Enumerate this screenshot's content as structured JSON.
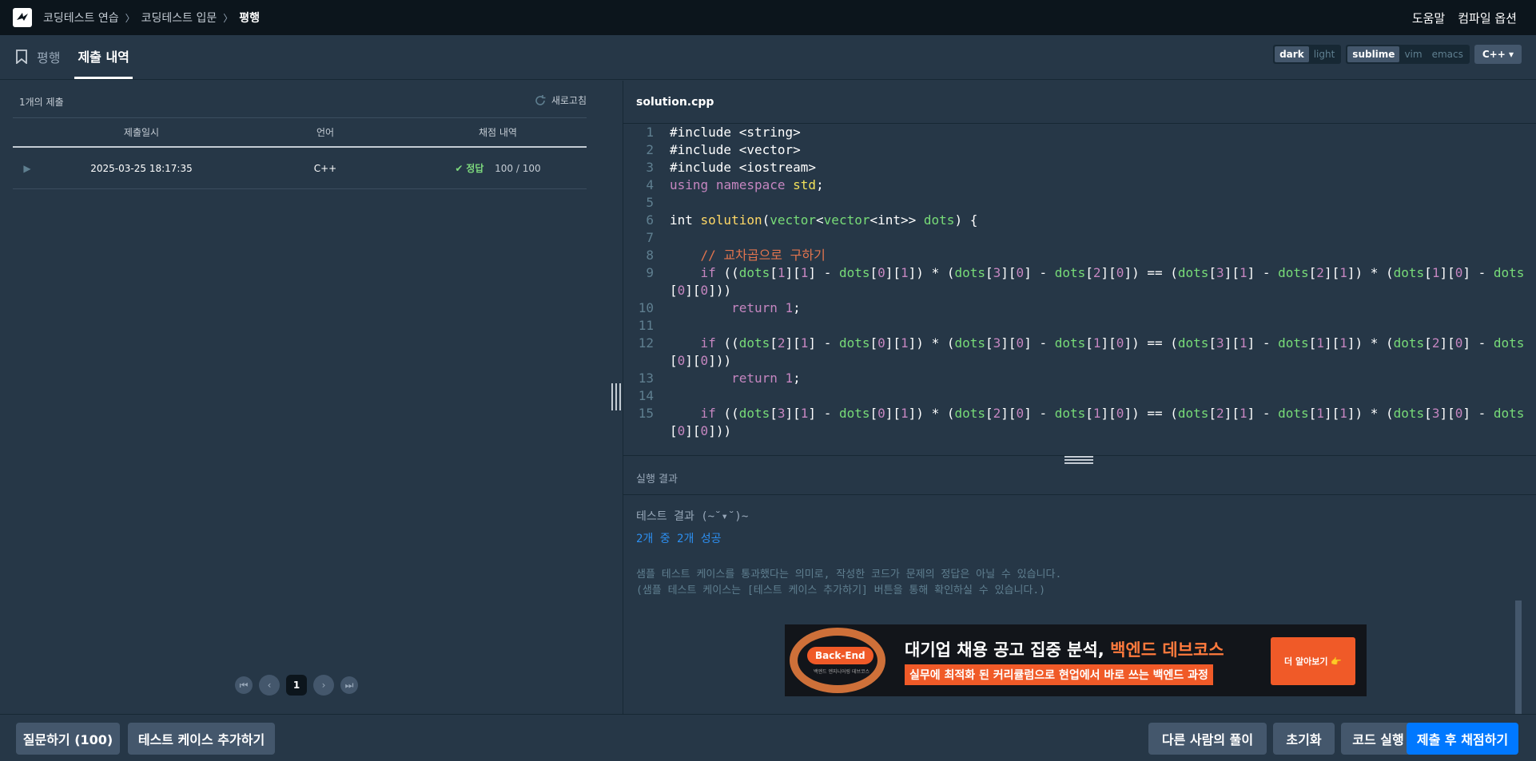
{
  "topbar": {
    "breadcrumb": [
      "코딩테스트 연습",
      "코딩테스트 입문",
      "평행"
    ],
    "help": "도움말",
    "compile_options": "컴파일 옵션"
  },
  "tabs": {
    "problem": "평행",
    "submissions": "제출 내역"
  },
  "editor_options": {
    "theme": [
      "dark",
      "light"
    ],
    "keymap": [
      "sublime",
      "vim",
      "emacs"
    ],
    "language": "C++"
  },
  "submissions": {
    "count_label": "1개의 제출",
    "refresh_label": "새로고침",
    "columns": [
      "제출일시",
      "언어",
      "채점 내역"
    ],
    "rows": [
      {
        "date": "2025-03-25 18:17:35",
        "lang": "C++",
        "status": "정답",
        "score": "100 / 100"
      }
    ],
    "pagination": {
      "current": "1"
    }
  },
  "editor": {
    "filename": "solution.cpp",
    "line_numbers": [
      "1",
      "2",
      "3",
      "4",
      "5",
      "6",
      "7",
      "8",
      "9",
      "",
      "10",
      "11",
      "12",
      "",
      "13",
      "14",
      "15",
      ""
    ]
  },
  "result": {
    "title": "실행 결과",
    "header": "테스트 결과 (~˘▾˘)~",
    "summary": "2개 중 2개 성공",
    "note1": "샘플 테스트 케이스를 통과했다는 의미로, 작성한 코드가 문제의 정답은 아닐 수 있습니다.",
    "note2": "(샘플 테스트 케이스는 [테스트 케이스 추가하기] 버튼을 통해 확인하실 수 있습니다.)"
  },
  "ad": {
    "badge": "Back-End",
    "sub": "백엔드 엔지니어링 데브코스",
    "title_plain": "대기업 채용 공고 집중 분석, ",
    "title_highlight": "백엔드 데브코스",
    "line": "실무에 최적화 된 커리큘럼으로 현업에서 바로 쓰는 백엔드 과정",
    "button": "더 알아보기 👉"
  },
  "footer": {
    "ask": "질문하기 (100)",
    "add_testcase": "테스트 케이스 추가하기",
    "others": "다른 사람의 풀이",
    "reset": "초기화",
    "run": "코드 실행",
    "submit": "제출 후 채점하기"
  }
}
